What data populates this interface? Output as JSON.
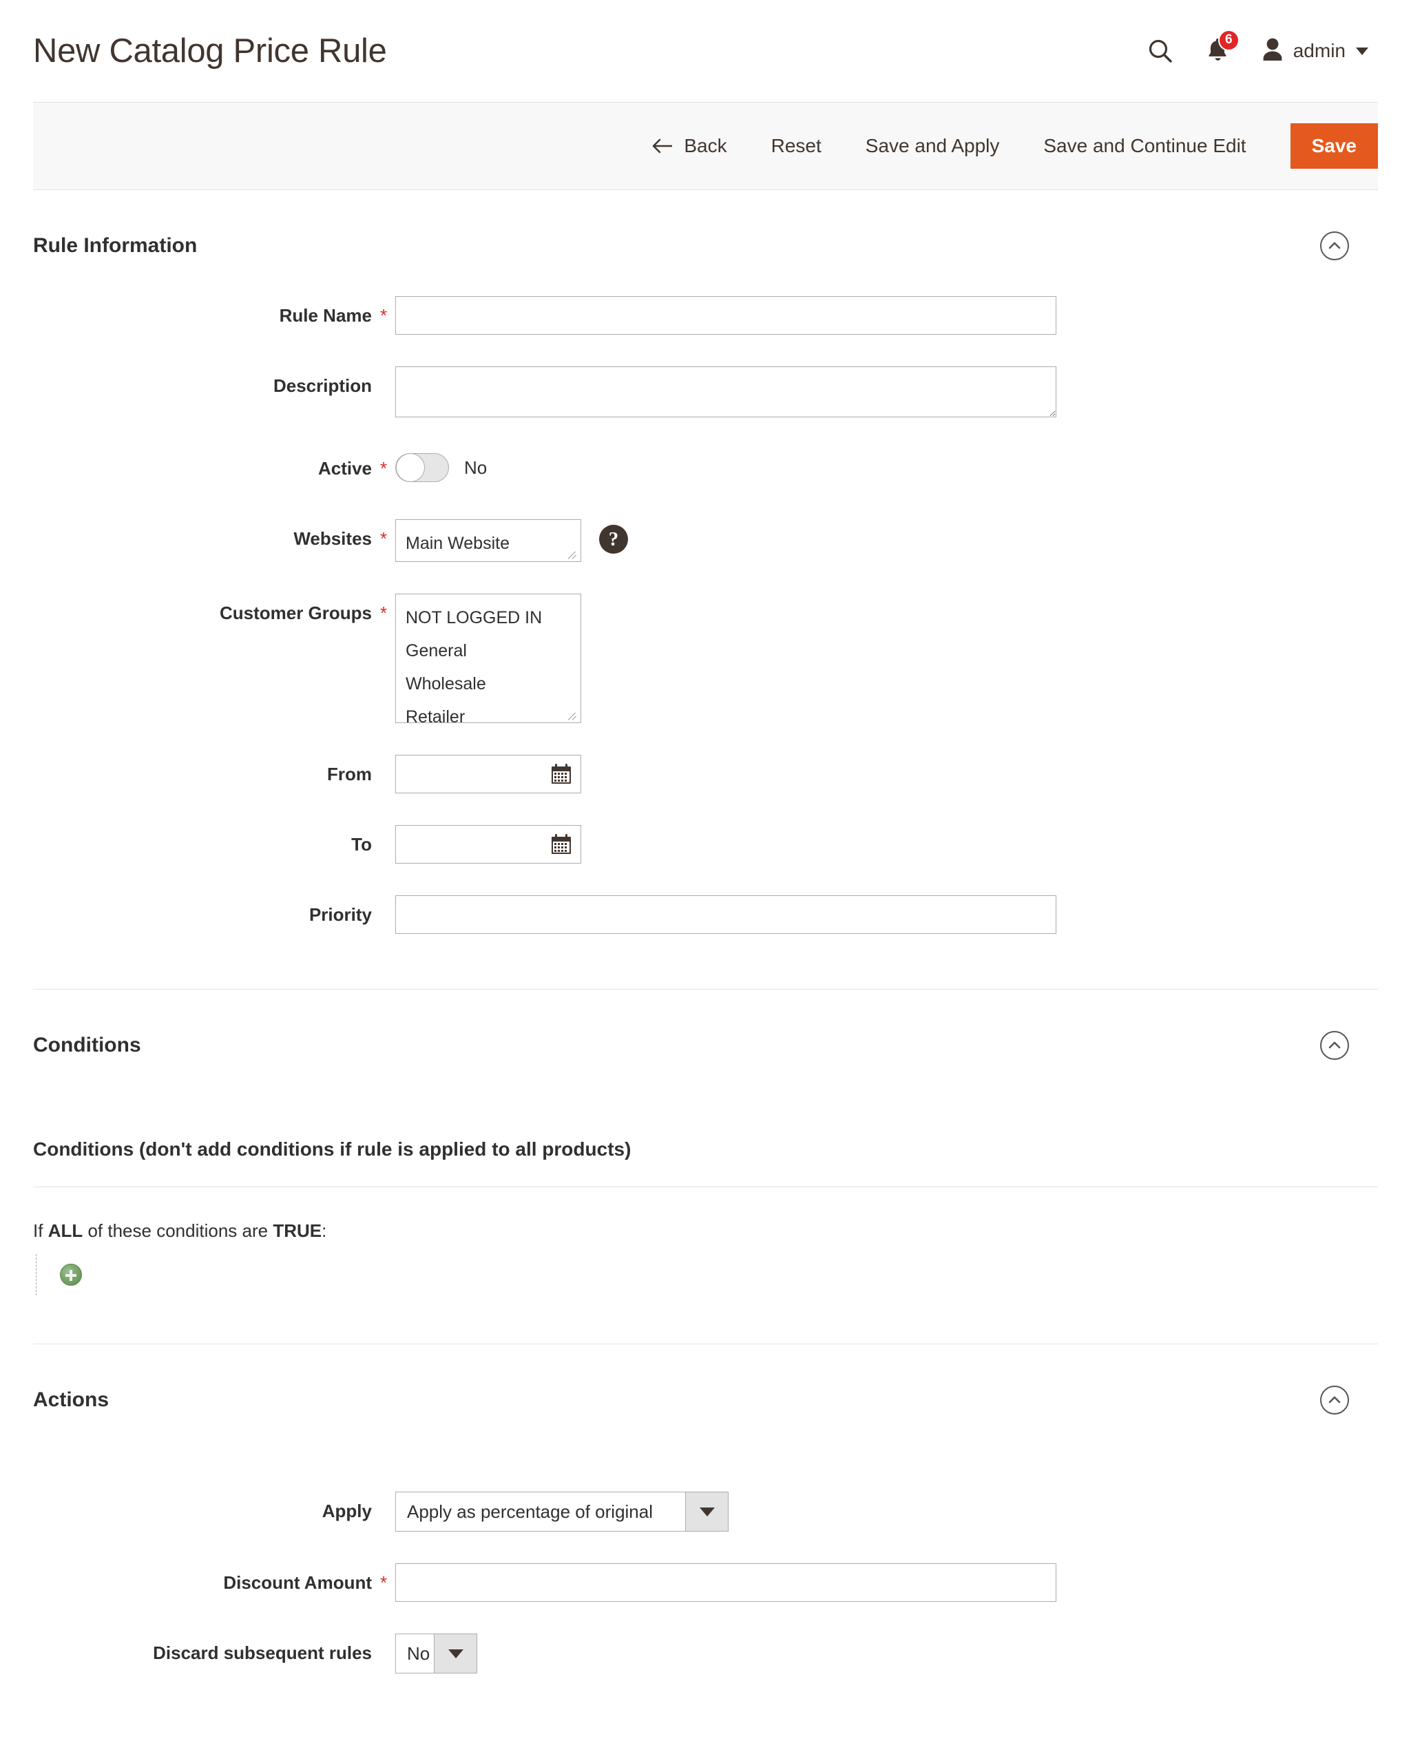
{
  "header": {
    "title": "New Catalog Price Rule",
    "search_icon": "search-icon",
    "notifications_icon": "bell-icon",
    "notifications_count": "6",
    "user_icon": "user-icon",
    "user_name": "admin",
    "user_caret": "chevron-down-icon"
  },
  "toolbar": {
    "back_label": "Back",
    "back_icon": "arrow-left-icon",
    "reset_label": "Reset",
    "save_apply_label": "Save and Apply",
    "save_continue_label": "Save and Continue Edit",
    "save_label": "Save",
    "save_color": "#e4591e"
  },
  "rule_information": {
    "section_title": "Rule Information",
    "collapse_icon": "chevron-up-circle-icon",
    "fields": {
      "rule_name": {
        "label": "Rule Name",
        "required": "*",
        "value": "",
        "placeholder": ""
      },
      "description": {
        "label": "Description",
        "value": "",
        "placeholder": ""
      },
      "active": {
        "label": "Active",
        "required": "*",
        "state_label": "No",
        "checked": "false"
      },
      "websites": {
        "label": "Websites",
        "required": "*",
        "options": [
          "Main Website"
        ],
        "help_icon": "question-mark-icon"
      },
      "customer_groups": {
        "label": "Customer Groups",
        "required": "*",
        "options": [
          "NOT LOGGED IN",
          "General",
          "Wholesale",
          "Retailer"
        ]
      },
      "from": {
        "label": "From",
        "value": "",
        "calendar_icon": "calendar-icon"
      },
      "to": {
        "label": "To",
        "value": "",
        "calendar_icon": "calendar-icon"
      },
      "priority": {
        "label": "Priority",
        "value": ""
      }
    }
  },
  "conditions": {
    "section_title": "Conditions",
    "collapse_icon": "chevron-up-circle-icon",
    "subtitle": "Conditions (don't add conditions if rule is applied to all products)",
    "sentence_prefix": "If",
    "sentence_all": "ALL",
    "sentence_middle": "of these conditions are",
    "sentence_true": "TRUE",
    "sentence_suffix": ":",
    "add_icon": "plus-circle-icon"
  },
  "actions": {
    "section_title": "Actions",
    "collapse_icon": "chevron-up-circle-icon",
    "fields": {
      "apply": {
        "label": "Apply",
        "value": "Apply as percentage of original",
        "arrow_icon": "chevron-down-icon"
      },
      "discount_amount": {
        "label": "Discount Amount",
        "required": "*",
        "value": ""
      },
      "discard_subsequent_rules": {
        "label": "Discard subsequent rules",
        "value": "No",
        "arrow_icon": "chevron-down-icon"
      }
    }
  }
}
